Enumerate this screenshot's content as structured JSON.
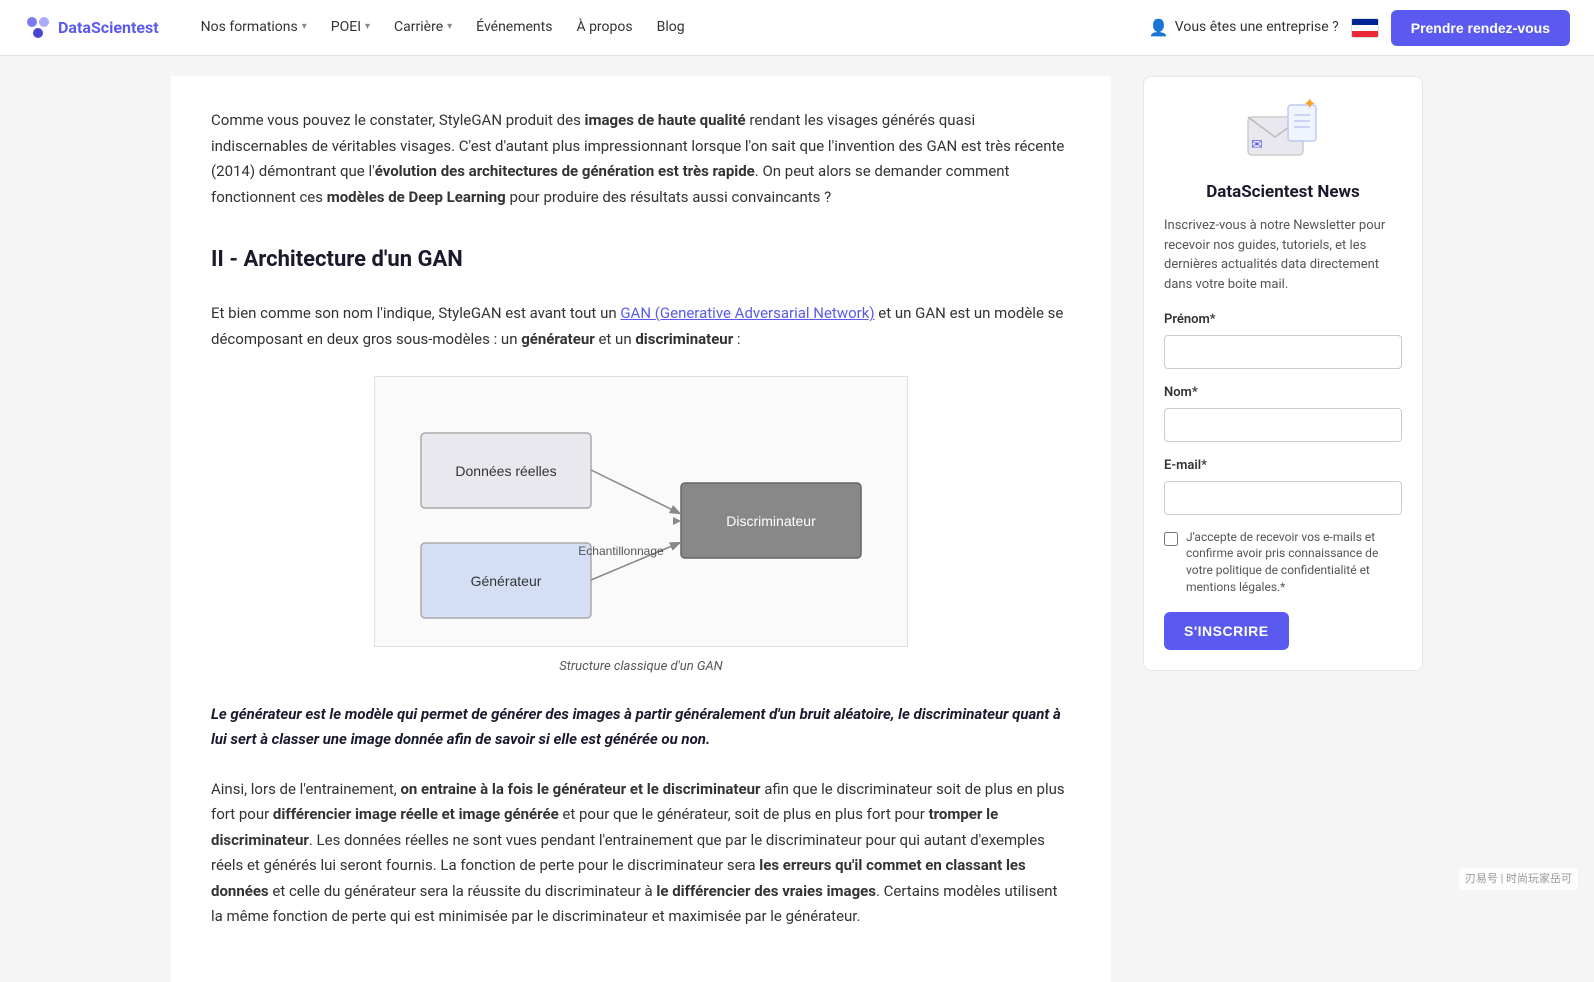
{
  "navbar": {
    "logo_text_part1": "DataScientest",
    "logo_icon": "📊",
    "nav_items": [
      {
        "label": "Nos formations",
        "has_dropdown": true
      },
      {
        "label": "POEI",
        "has_dropdown": true
      },
      {
        "label": "Carrière",
        "has_dropdown": true
      },
      {
        "label": "Événements",
        "has_dropdown": false
      },
      {
        "label": "À propos",
        "has_dropdown": false
      },
      {
        "label": "Blog",
        "has_dropdown": false
      }
    ],
    "enterprise_label": "Vous êtes une entreprise ?",
    "cta_label": "Prendre rendez-vous"
  },
  "article": {
    "intro_paragraph": "Comme vous pouvez le constater, StyleGAN produit des ",
    "intro_bold1": "images de haute qualité",
    "intro_rest1": " rendant les visages générés quasi indiscernables de véritables visages. C'est d'autant plus impressionnant lorsque l'on sait que l'invention des GAN est très récente (2014) démontrant que l'",
    "intro_bold2": "évolution des architectures de génération est très rapide",
    "intro_rest2": ". On peut alors se demander comment fonctionnent ces ",
    "intro_bold3": "modèles de Deep Learning",
    "intro_rest3": " pour produire des résultats aussi convaincants ?",
    "section_title": "II - Architecture d'un GAN",
    "section_intro": "Et bien comme son nom l'indique, StyleGAN est avant tout un ",
    "section_link": "GAN (Generative Adversarial Network)",
    "section_intro2": " et un GAN est un modèle se décomposant en deux gros sous-modèles : un ",
    "section_bold_gen": "générateur",
    "section_intro3": " et un ",
    "section_bold_disc": "discriminateur",
    "section_intro4": " :",
    "diagram_caption": "Structure classique d'un GAN",
    "diagram_label_donnees": "Données réelles",
    "diagram_label_echantillonnage": "Echantillonnage",
    "diagram_label_discriminateur": "Discriminateur",
    "diagram_label_generateur": "Générateur",
    "blockquote": "Le générateur est le modèle qui permet de générer des images à partir généralement d'un bruit aléatoire, le discriminateur quant à lui sert à classer une image donnée afin de savoir si elle est générée ou non.",
    "body2_intro": "Ainsi, lors de l'entrainement, ",
    "body2_bold1": "on entraine à la fois le générateur et le discriminateur",
    "body2_rest1": " afin que le discriminateur soit de plus en plus fort pour ",
    "body2_bold2": "différencier image réelle et image générée",
    "body2_rest2": " et pour que le générateur, soit de plus en plus fort pour ",
    "body2_bold3": "tromper le discriminateur",
    "body2_rest3": ". Les données réelles ne sont vues pendant l'entrainement que par le discriminateur pour qui autant d'exemples réels et générés lui seront fournis. La fonction de perte pour le discriminateur sera ",
    "body2_bold4": "les erreurs qu'il commet en classant les données",
    "body2_rest4": " et celle du générateur sera la réussite du discriminateur à ",
    "body2_bold5": "le différencier des vraies images",
    "body2_rest5": ". Certains modèles utilisent la même fonction de perte qui est minimisée par le discriminateur et maximisée par le générateur."
  },
  "sidebar": {
    "newsletter_title": "DataScientest News",
    "newsletter_desc": "Inscrivez-vous à notre Newsletter pour recevoir nos guides, tutoriels, et les dernières actualités data directement dans votre boite mail.",
    "field_prenom_label": "Prénom*",
    "field_nom_label": "Nom*",
    "field_email_label": "E-mail*",
    "field_prenom_placeholder": "",
    "field_nom_placeholder": "",
    "field_email_placeholder": "",
    "checkbox_label": "J'accepte de recevoir vos e-mails et confirme avoir pris connaissance de votre politique de confidentialité et mentions légales.*",
    "btn_subscribe_label": "S'INSCRIRE"
  },
  "watermark": "刃易号 | 时尚玩家岳可"
}
